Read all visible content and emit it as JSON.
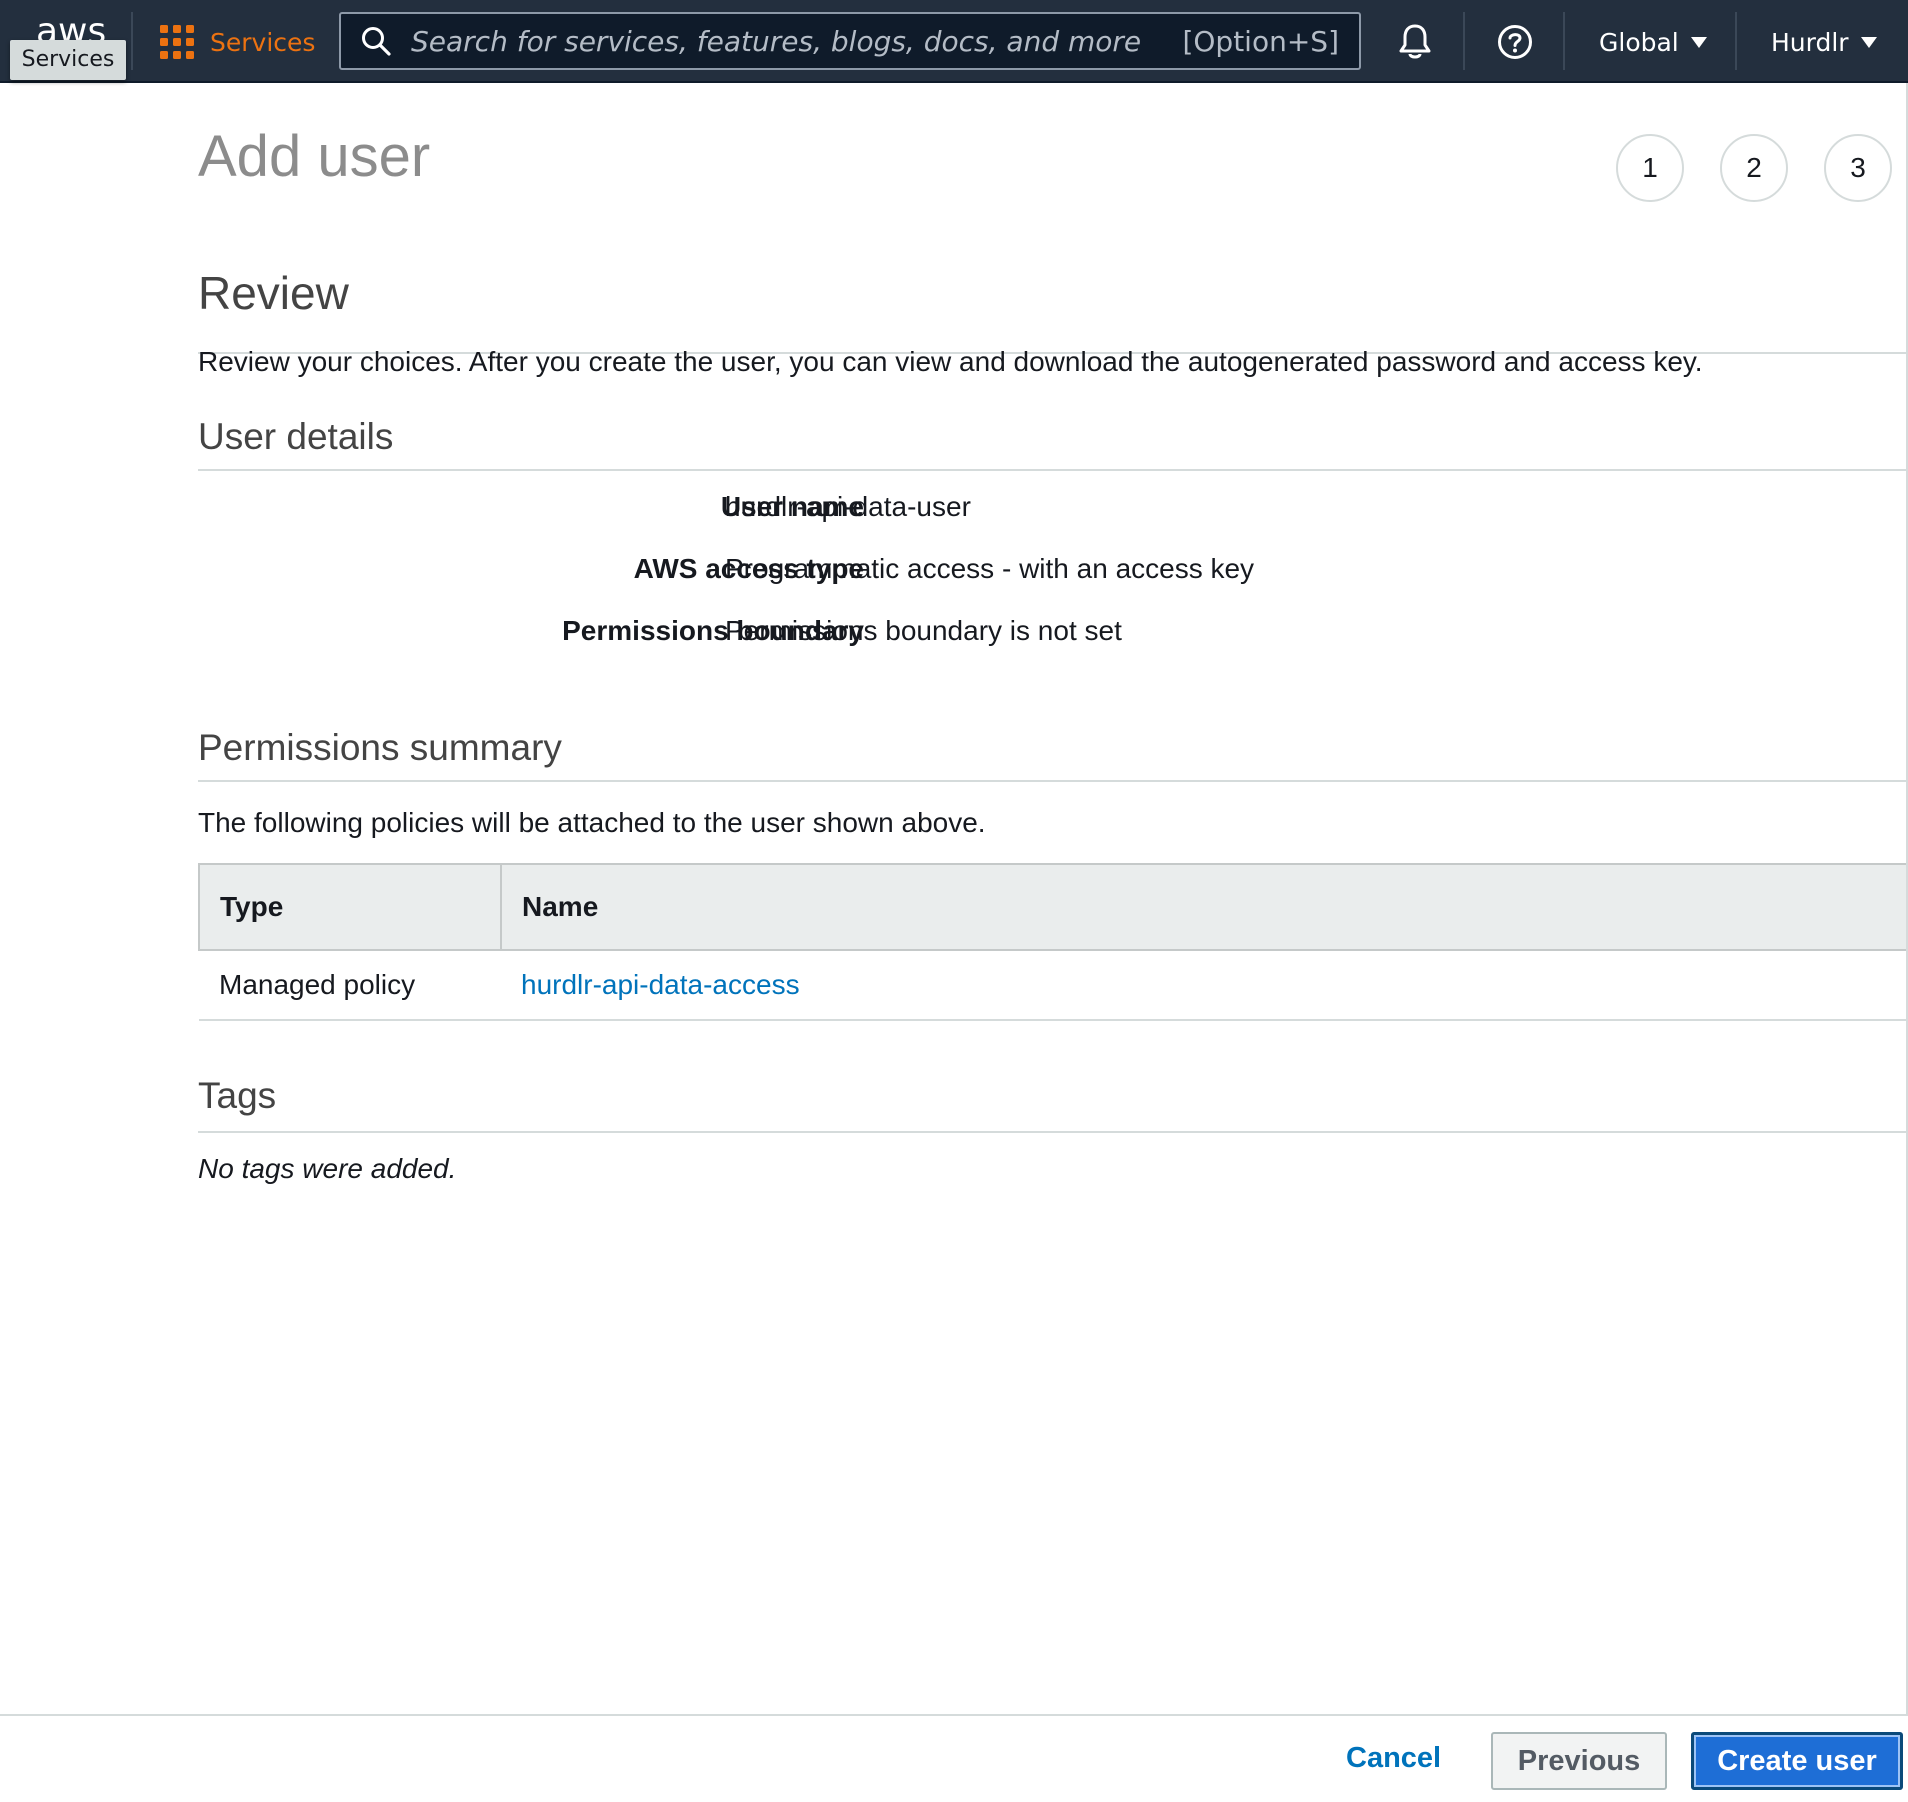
{
  "nav": {
    "logo_text": "aws",
    "logo_tooltip": "Services",
    "services_label": "Services",
    "search_placeholder": "Search for services, features, blogs, docs, and more",
    "search_shortcut": "[Option+S]",
    "region": "Global",
    "account": "Hurdlr",
    "icons": [
      "services-grid-icon",
      "search-icon",
      "bell-icon",
      "help-icon",
      "caret-down-icon"
    ],
    "accent_color": "#ec7211",
    "background_color": "#232f3e"
  },
  "page": {
    "title": "Add user",
    "steps": [
      "1",
      "2",
      "3"
    ]
  },
  "review": {
    "heading": "Review",
    "description": "Review your choices. After you create the user, you can view and download the autogenerated password and access key."
  },
  "user_details": {
    "heading": "User details",
    "rows": [
      {
        "label": "User name",
        "value": "hurdlr-api-data-user"
      },
      {
        "label": "AWS access type",
        "value": "Programmatic access - with an access key"
      },
      {
        "label": "Permissions boundary",
        "value": "Permissions boundary is not set"
      }
    ]
  },
  "permissions": {
    "heading": "Permissions summary",
    "description": "The following policies will be attached to the user shown above.",
    "columns": [
      "Type",
      "Name"
    ],
    "rows": [
      {
        "type": "Managed policy",
        "name": "hurdlr-api-data-access"
      }
    ],
    "link_color": "#0073bb"
  },
  "tags": {
    "heading": "Tags",
    "empty_text": "No tags were added."
  },
  "footer": {
    "cancel_label": "Cancel",
    "previous_label": "Previous",
    "create_label": "Create user",
    "primary_color": "#1e6ed6"
  }
}
